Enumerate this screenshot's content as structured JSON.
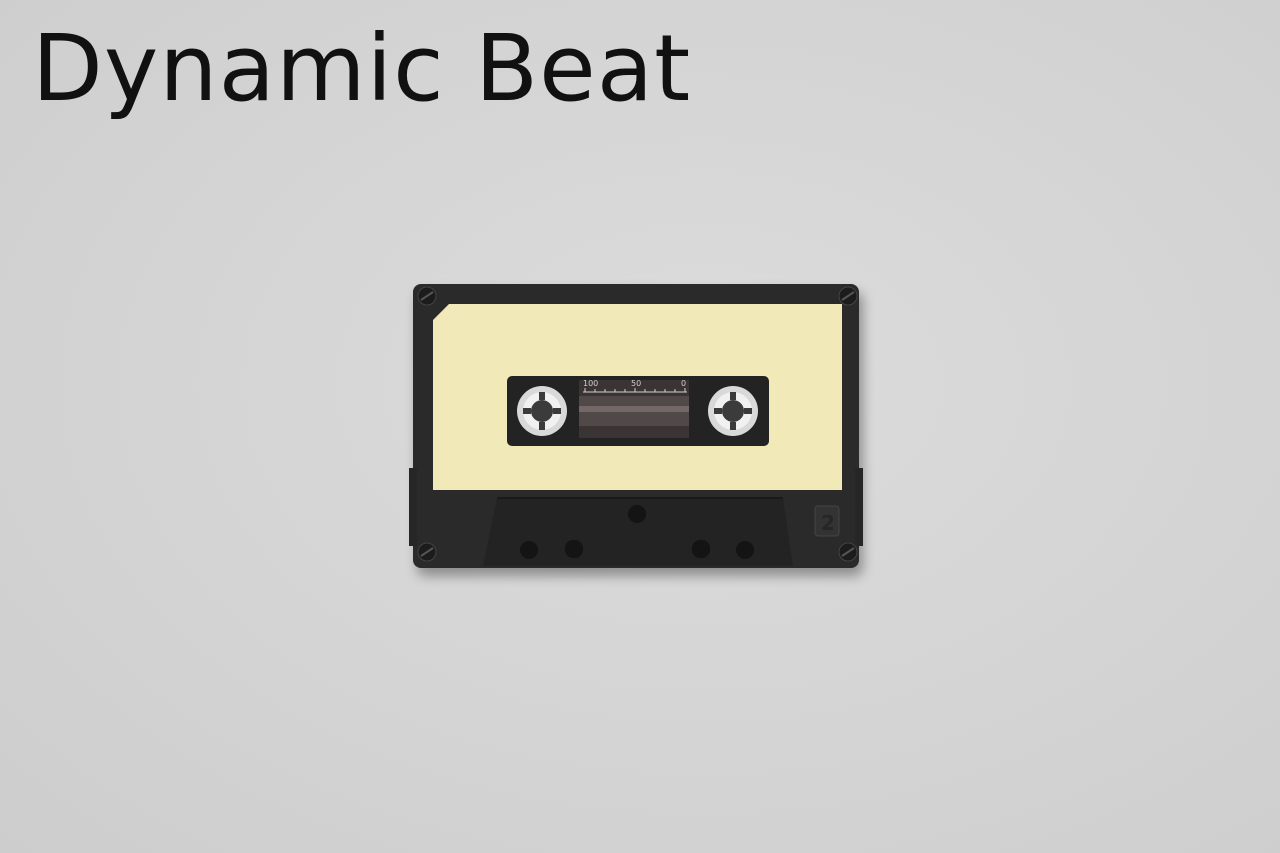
{
  "headline": "Dynamic Beat",
  "cassette": {
    "counter_labels": [
      "100",
      "50",
      "0"
    ],
    "side_label": "2",
    "colors": {
      "shell": "#2a2a2a",
      "label": "#f2e9b9",
      "background": "#d6d6d6"
    }
  }
}
